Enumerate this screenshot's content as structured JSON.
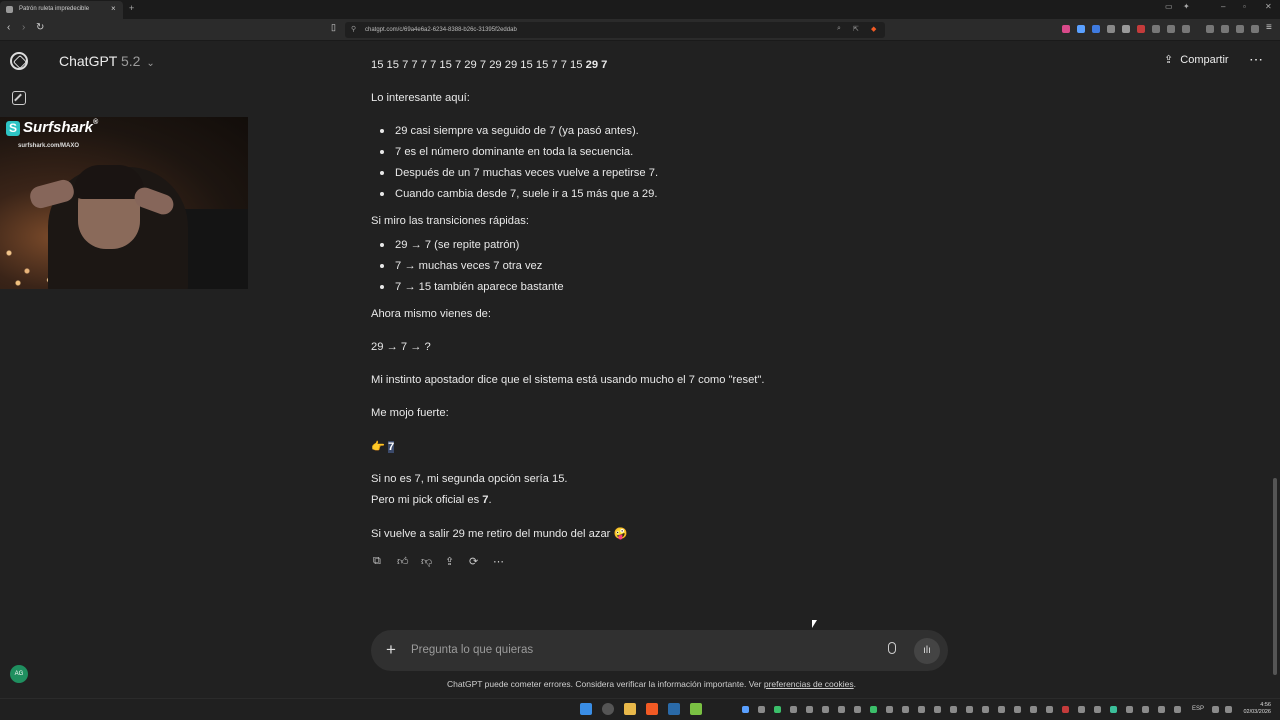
{
  "browser": {
    "tab_title": "Patrón ruleta impredecible",
    "url": "chatgpt.com/c/69a4e6a2-6234-8388-b26c-31395f2eddab"
  },
  "header": {
    "model_name": "ChatGPT",
    "model_version": "5.2",
    "share_label": "Compartir"
  },
  "webcam": {
    "brand": "Surfshark",
    "url": "surfshark.com/MAXO"
  },
  "message": {
    "sequence_prefix": "15 15 7 7 7 7 15 7 29 7 29 29 15 15 7 7 15 ",
    "sequence_bold": "29 7",
    "p1": "Lo interesante aquí:",
    "bullets1": [
      "29 casi siempre va seguido de 7 (ya pasó antes).",
      "7 es el número dominante en toda la secuencia.",
      "Después de un 7 muchas veces vuelve a repetirse 7.",
      "Cuando cambia desde 7, suele ir a 15 más que a 29."
    ],
    "p2": "Si miro las transiciones rápidas:",
    "bullets2": [
      "29 → 7 (se repite patrón)",
      "7 → muchas veces 7 otra vez",
      "7 → 15 también aparece bastante"
    ],
    "p3": "Ahora mismo vienes de:",
    "p4": "29 → 7 → ?",
    "p5": "Mi instinto apostador dice que el sistema está usando mucho el 7 como \"reset\".",
    "p6": "Me mojo fuerte:",
    "pick_emoji": "👉",
    "pick_value": "7",
    "p7": "Si no es 7, mi segunda opción sería 15.",
    "p8_prefix": "Pero mi pick oficial es ",
    "p8_bold": "7",
    "p8_suffix": ".",
    "p9": "Si vuelve a salir 29 me retiro del mundo del azar 🤪"
  },
  "composer": {
    "placeholder": "Pregunta lo que quieras"
  },
  "footer": {
    "disclaimer": "ChatGPT puede cometer errores. Considera verificar la información importante. Ver ",
    "cookie_link": "preferencias de cookies",
    "disclaimer_end": "."
  },
  "sidebar": {
    "avatar_initials": "AG"
  },
  "taskbar": {
    "language": "ESP",
    "time": "4:56",
    "date": "02/03/2026"
  }
}
